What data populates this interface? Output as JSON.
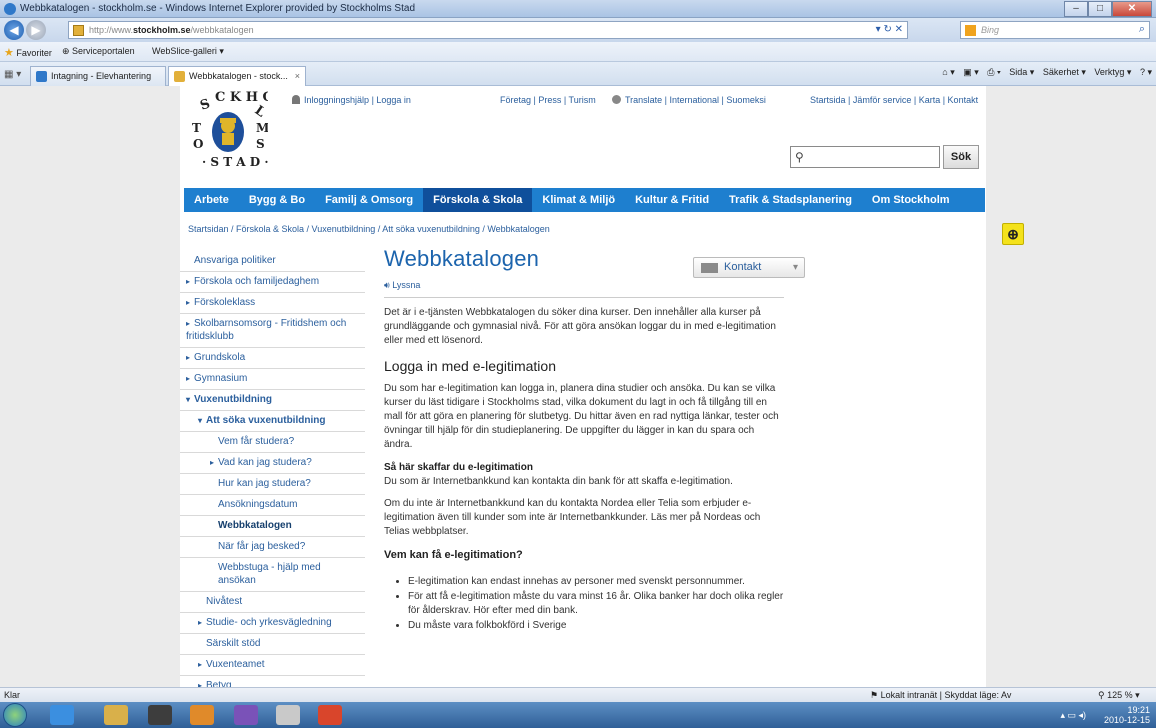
{
  "browser": {
    "title": "Webbkatalogen - stockholm.se - Windows Internet Explorer provided by Stockholms Stad",
    "url_prefix": "http://www.",
    "url_domain": "stockholm.se",
    "url_path": "/webbkatalogen",
    "search_placeholder": "Bing",
    "favorites_label": "Favoriter",
    "fav_items": [
      "Serviceportalen",
      "WebSlice-galleri ▾"
    ],
    "tabs": [
      {
        "label": "Intagning - Elevhantering"
      },
      {
        "label": "Webbkatalogen - stock..."
      }
    ],
    "commands": [
      "Sida ▾",
      "Säkerhet ▾",
      "Verktyg ▾"
    ],
    "status_left": "Klar",
    "status_zone": "Lokalt intranät | Skyddat läge: Av",
    "zoom": "125 %",
    "clock_time": "19:21",
    "clock_date": "2010-12-15"
  },
  "site": {
    "top_links_login": [
      "Inloggningshjälp",
      "Logga in"
    ],
    "top_links_biz": "Företag | Press | Turism",
    "top_links_lang": "Translate | International | Suomeksi",
    "top_links_right": "Startsida | Jämför service | Karta | Kontakt",
    "search_button": "Sök",
    "nav": [
      "Arbete",
      "Bygg & Bo",
      "Familj & Omsorg",
      "Förskola & Skola",
      "Klimat & Miljö",
      "Kultur & Fritid",
      "Trafik & Stadsplanering",
      "Om Stockholm"
    ],
    "breadcrumb": "Startsidan / Förskola & Skola / Vuxenutbildning / Att söka vuxenutbildning / Webbkatalogen",
    "kontakt_label": "Kontakt",
    "sidebar": [
      {
        "label": "Ansvariga politiker",
        "indent": 0,
        "arrow": "",
        "style": ""
      },
      {
        "label": "Förskola och familjedaghem",
        "indent": 0,
        "arrow": "▸",
        "style": ""
      },
      {
        "label": "Förskoleklass",
        "indent": 0,
        "arrow": "▸",
        "style": ""
      },
      {
        "label": "Skolbarnsomsorg - Fritidshem och fritidsklubb",
        "indent": 0,
        "arrow": "▸",
        "style": ""
      },
      {
        "label": "Grundskola",
        "indent": 0,
        "arrow": "▸",
        "style": ""
      },
      {
        "label": "Gymnasium",
        "indent": 0,
        "arrow": "▸",
        "style": ""
      },
      {
        "label": "Vuxenutbildning",
        "indent": 0,
        "arrow": "▾",
        "style": "bold"
      },
      {
        "label": "Att söka vuxenutbildning",
        "indent": 1,
        "arrow": "▾",
        "style": "bold"
      },
      {
        "label": "Vem får studera?",
        "indent": 2,
        "arrow": "",
        "style": ""
      },
      {
        "label": "Vad kan jag studera?",
        "indent": 2,
        "arrow": "▸",
        "style": ""
      },
      {
        "label": "Hur kan jag studera?",
        "indent": 2,
        "arrow": "",
        "style": ""
      },
      {
        "label": "Ansökningsdatum",
        "indent": 2,
        "arrow": "",
        "style": ""
      },
      {
        "label": "Webbkatalogen",
        "indent": 2,
        "arrow": "",
        "style": "current"
      },
      {
        "label": "När får jag besked?",
        "indent": 2,
        "arrow": "",
        "style": ""
      },
      {
        "label": "Webbstuga - hjälp med ansökan",
        "indent": 2,
        "arrow": "",
        "style": ""
      },
      {
        "label": "Nivåtest",
        "indent": 1,
        "arrow": "",
        "style": ""
      },
      {
        "label": "Studie- och yrkesvägledning",
        "indent": 1,
        "arrow": "▸",
        "style": ""
      },
      {
        "label": "Särskilt stöd",
        "indent": 1,
        "arrow": "",
        "style": ""
      },
      {
        "label": "Vuxenteamet",
        "indent": 1,
        "arrow": "▸",
        "style": ""
      },
      {
        "label": "Betyg",
        "indent": 1,
        "arrow": "▸",
        "style": ""
      }
    ],
    "content": {
      "title": "Webbkatalogen",
      "lyssna": "Lyssna",
      "intro": "Det är i e-tjänsten Webbkatalogen du söker dina kurser. Den innehåller alla kurser på grundläggande och gymnasial nivå. För att göra ansökan loggar du in med e-legitimation eller med ett lösenord.",
      "h2": "Logga in med e-legitimation",
      "p1": "Du som har e-legitimation kan logga in, planera dina studier och ansöka. Du kan se vilka kurser du läst tidigare i Stockholms stad, vilka dokument du lagt in och få tillgång till en mall för att göra en planering för slutbetyg. Du hittar även en rad nyttiga länkar, tester och övningar till hjälp för din studieplanering. De uppgifter du lägger in kan du spara och ändra.",
      "h3": "Så här skaffar du e-legitimation",
      "p2": "Du som är Internetbankkund kan kontakta din bank för att skaffa e-legitimation.",
      "p3": "Om du inte är Internetbankkund kan du kontakta Nordea eller Telia som erbjuder e-legitimation även till kunder som inte är Internetbankkunder. Läs mer på Nordeas och Telias webbplatser.",
      "h4": "Vem kan få e-legitimation?",
      "bullets": [
        "E-legitimation kan endast innehas av personer med svenskt personnummer.",
        "För att få e-legitimation måste du vara minst 16 år. Olika banker har doch olika regler för ålderskrav. Hör efter med din bank.",
        "Du måste vara folkbokförd i Sverige"
      ]
    }
  }
}
